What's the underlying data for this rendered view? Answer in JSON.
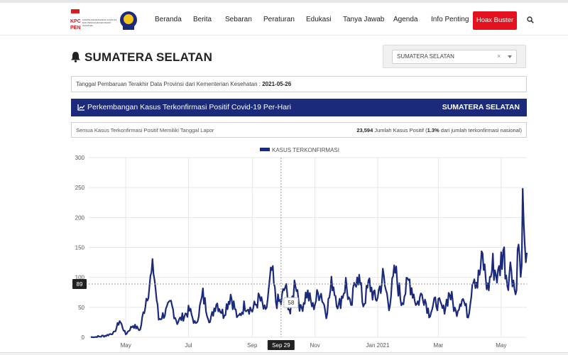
{
  "navbar": {
    "logo_a_text": "KOMITE PENANGANAN COVID-19 DAN PEMULIHAN EKONOMI NASIONAL",
    "items": [
      "Beranda",
      "Berita",
      "Sebaran",
      "Peraturan",
      "Edukasi",
      "Tanya Jawab",
      "Agenda",
      "Info Penting"
    ],
    "hoax_label": "Hoax Buster",
    "hoax_color": "#e3121e"
  },
  "header": {
    "title": "SUMATERA SELATAN",
    "select_value": "SUMATERA SELATAN",
    "select_clear": "×"
  },
  "update": {
    "label": "Tanggal Pembaruan Terakhir Data Provinsi dari Kementerian Kesehatan :",
    "date": "2021-05-26"
  },
  "chart_header": {
    "title": "Perkembangan Kasus Terkonfirmasi Positif Covid-19 Per-Hari",
    "region": "SUMATERA SELATAN",
    "color": "#1b2a7a"
  },
  "summary": {
    "left": "Semua Kasus Terkonfirmasi Positif Memiliki Tanggal Lapor",
    "total": "23,594",
    "total_label": "Jumlah Kasus Positif (",
    "pct": "1.3%",
    "pct_label": "dari jumlah terkonfirmasi nasional)"
  },
  "chart_data": {
    "type": "line",
    "series": [
      {
        "name": "KASUS TERKONFIRMASI",
        "color": "#1b2a7a",
        "anchors": [
          [
            "2020-03-28",
            0
          ],
          [
            "2020-04-05",
            1
          ],
          [
            "2020-04-12",
            3
          ],
          [
            "2020-04-20",
            8
          ],
          [
            "2020-04-25",
            28
          ],
          [
            "2020-05-01",
            5
          ],
          [
            "2020-05-08",
            20
          ],
          [
            "2020-05-15",
            12
          ],
          [
            "2020-05-22",
            75
          ],
          [
            "2020-05-28",
            115
          ],
          [
            "2020-06-02",
            30
          ],
          [
            "2020-06-08",
            40
          ],
          [
            "2020-06-14",
            55
          ],
          [
            "2020-06-20",
            25
          ],
          [
            "2020-06-26",
            35
          ],
          [
            "2020-07-02",
            45
          ],
          [
            "2020-07-08",
            20
          ],
          [
            "2020-07-15",
            70
          ],
          [
            "2020-07-22",
            25
          ],
          [
            "2020-07-28",
            60
          ],
          [
            "2020-08-04",
            38
          ],
          [
            "2020-08-11",
            72
          ],
          [
            "2020-08-18",
            30
          ],
          [
            "2020-08-25",
            55
          ],
          [
            "2020-09-01",
            45
          ],
          [
            "2020-09-08",
            65
          ],
          [
            "2020-09-14",
            40
          ],
          [
            "2020-09-20",
            110
          ],
          [
            "2020-09-24",
            60
          ],
          [
            "2020-09-29",
            58
          ],
          [
            "2020-10-03",
            85
          ],
          [
            "2020-10-08",
            40
          ],
          [
            "2020-10-13",
            100
          ],
          [
            "2020-10-18",
            45
          ],
          [
            "2020-10-24",
            75
          ],
          [
            "2020-10-30",
            50
          ],
          [
            "2020-11-06",
            80
          ],
          [
            "2020-11-12",
            40
          ],
          [
            "2020-11-18",
            95
          ],
          [
            "2020-11-24",
            50
          ],
          [
            "2020-12-01",
            90
          ],
          [
            "2020-12-06",
            45
          ],
          [
            "2020-12-12",
            115
          ],
          [
            "2020-12-18",
            55
          ],
          [
            "2020-12-24",
            90
          ],
          [
            "2020-12-30",
            60
          ],
          [
            "2021-01-06",
            100
          ],
          [
            "2021-01-12",
            55
          ],
          [
            "2021-01-18",
            110
          ],
          [
            "2021-01-24",
            60
          ],
          [
            "2021-02-01",
            95
          ],
          [
            "2021-02-08",
            55
          ],
          [
            "2021-02-14",
            75
          ],
          [
            "2021-02-20",
            40
          ],
          [
            "2021-02-27",
            60
          ],
          [
            "2021-03-06",
            45
          ],
          [
            "2021-03-12",
            75
          ],
          [
            "2021-03-18",
            40
          ],
          [
            "2021-03-24",
            70
          ],
          [
            "2021-03-30",
            35
          ],
          [
            "2021-04-04",
            110
          ],
          [
            "2021-04-08",
            90
          ],
          [
            "2021-04-13",
            130
          ],
          [
            "2021-04-18",
            80
          ],
          [
            "2021-04-23",
            120
          ],
          [
            "2021-04-28",
            100
          ],
          [
            "2021-05-03",
            148
          ],
          [
            "2021-05-07",
            95
          ],
          [
            "2021-05-11",
            120
          ],
          [
            "2021-05-15",
            70
          ],
          [
            "2021-05-18",
            160
          ],
          [
            "2021-05-20",
            90
          ],
          [
            "2021-05-22",
            205
          ],
          [
            "2021-05-24",
            130
          ],
          [
            "2021-05-26",
            155
          ]
        ]
      }
    ],
    "xlim": [
      "2020-03-26",
      "2021-05-26"
    ],
    "x_ticks": [
      {
        "date": "2020-05-01",
        "label": "May"
      },
      {
        "date": "2020-07-01",
        "label": "Jul"
      },
      {
        "date": "2020-09-01",
        "label": "Sep"
      },
      {
        "date": "2020-11-01",
        "label": "Nov"
      },
      {
        "date": "2021-01-01",
        "label": "Jan 2021"
      },
      {
        "date": "2021-03-01",
        "label": "Mar"
      },
      {
        "date": "2021-05-01",
        "label": "May"
      }
    ],
    "ylim": [
      0,
      300
    ],
    "y_ticks": [
      0,
      50,
      100,
      150,
      200,
      250,
      300
    ],
    "grid": true,
    "legend": "top-center",
    "crosshair": {
      "date": "2020-09-29",
      "date_label": "Sep 29",
      "y_level": 89,
      "y_label": "89",
      "point_label": "58"
    }
  }
}
